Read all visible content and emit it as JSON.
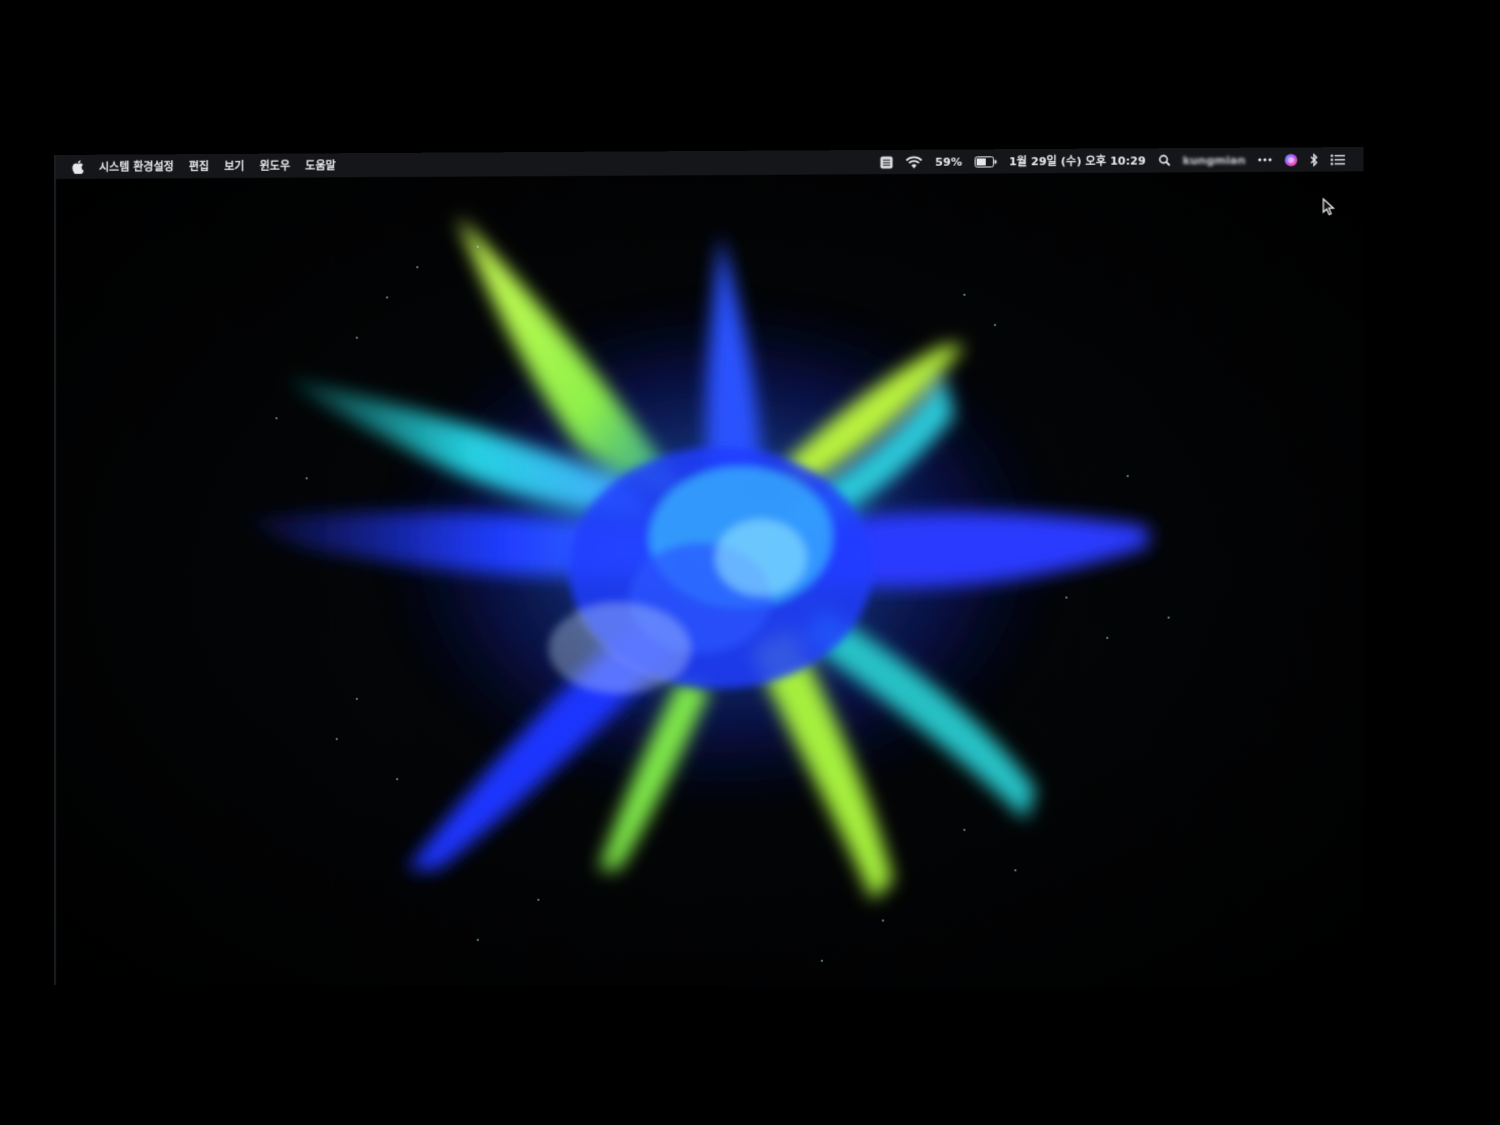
{
  "menubar": {
    "app_name": "시스템 환경설정",
    "menus": [
      "편집",
      "보기",
      "윈도우",
      "도움말"
    ],
    "status": {
      "battery_percent": "59%",
      "datetime": "1월 29일 (수) 오후 10:29",
      "username": "kungmian"
    },
    "icons": [
      "apple-icon",
      "input-source-icon",
      "wifi-icon",
      "battery-icon",
      "spotlight-icon",
      "more-icon",
      "siri-icon",
      "bluetooth-icon",
      "notification-center-icon"
    ]
  },
  "colors": {
    "menubar_bg": "#141619",
    "wallpaper_bg": "#020304",
    "burst_blue": "#1a3cff",
    "burst_cyan": "#19c6d8",
    "burst_lime": "#b7f03a"
  }
}
